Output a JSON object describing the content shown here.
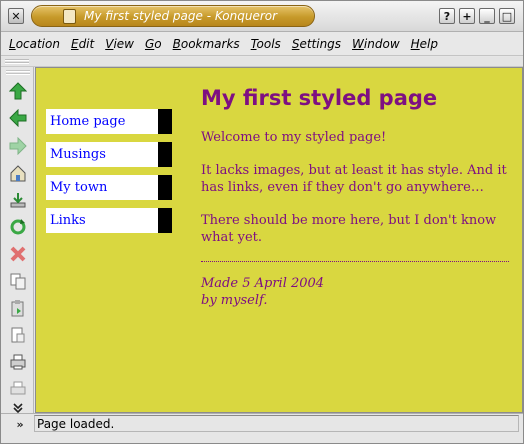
{
  "window": {
    "title": "My first styled page - Konqueror",
    "title_buttons": [
      "?",
      "+",
      "_",
      "□"
    ]
  },
  "menubar": {
    "items": [
      "Location",
      "Edit",
      "View",
      "Go",
      "Bookmarks",
      "Tools",
      "Settings",
      "Window",
      "Help"
    ]
  },
  "toolbar": {
    "icons": [
      "up-arrow-icon",
      "back-arrow-icon",
      "forward-arrow-icon",
      "home-icon",
      "download-icon",
      "reload-icon",
      "stop-icon",
      "copy-icon",
      "paste-icon",
      "page-icon",
      "print-icon",
      "printer-alt-icon",
      "more-chevron-icon"
    ]
  },
  "page": {
    "nav": [
      "Home page",
      "Musings",
      "My town",
      "Links"
    ],
    "heading": "My first styled page",
    "paragraphs": [
      "Welcome to my styled page!",
      "It lacks images, but at least it has style. And it has links, even if they don't go anywhere…",
      "There should be more here, but I don't know what yet."
    ],
    "footer_line1": "Made 5 April 2004",
    "footer_line2": "by myself.",
    "colors": {
      "background": "#d9d740",
      "text": "#7e0f82",
      "link": "#0000ff",
      "nav_background": "#ffffff",
      "nav_border": "#000000"
    }
  },
  "statusbar": {
    "text": "Page loaded."
  }
}
